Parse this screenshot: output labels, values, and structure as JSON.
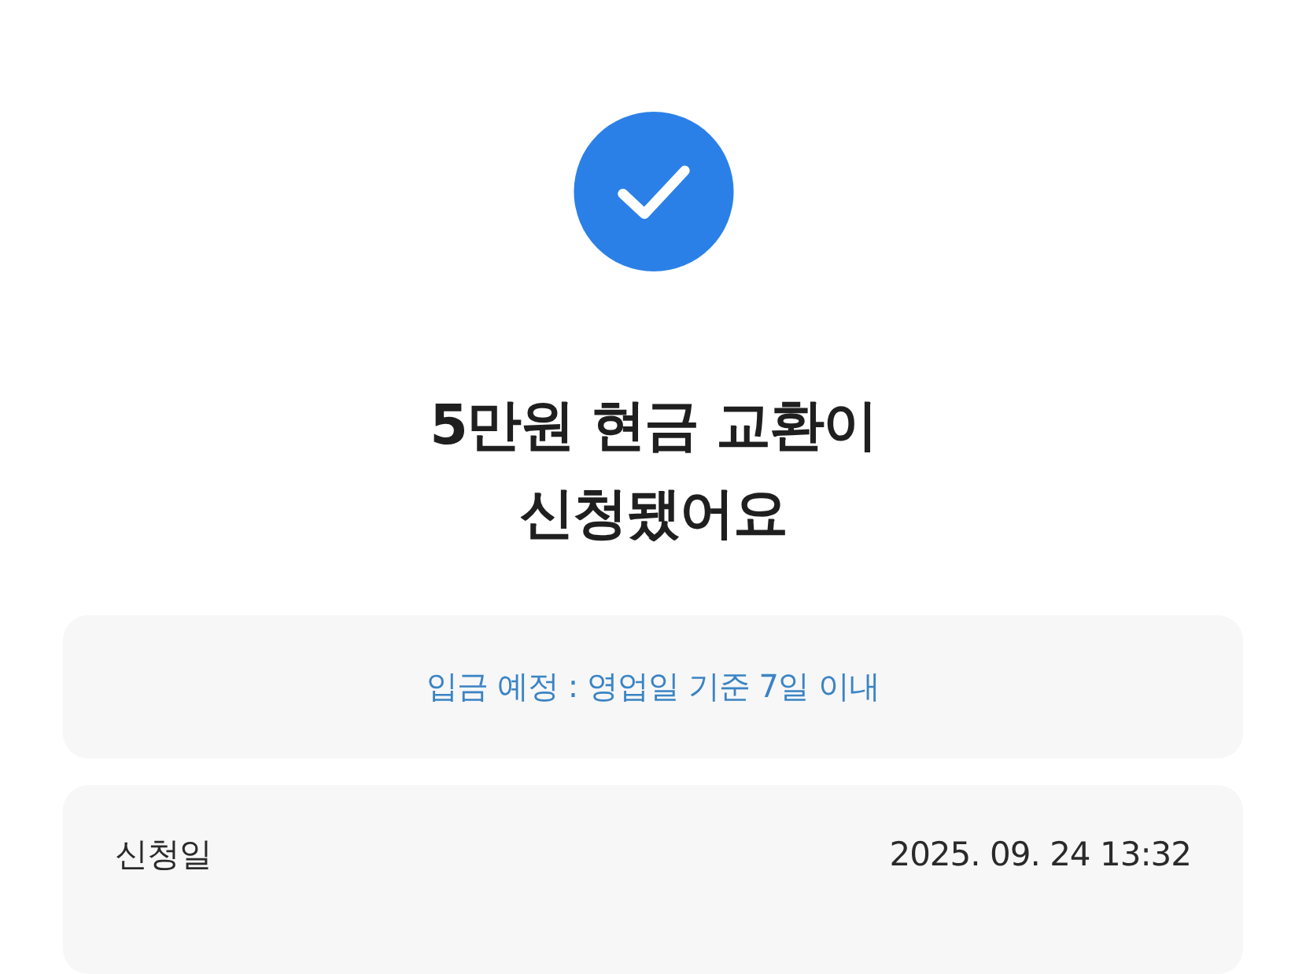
{
  "title_lines": [
    "5만원 현금 교환이",
    "신청됐어요"
  ],
  "notice": "입금 예정 : 영업일 기준 7일 이내",
  "details": [
    {
      "label": "신청일",
      "value": "2025. 09. 24 13:32"
    }
  ]
}
